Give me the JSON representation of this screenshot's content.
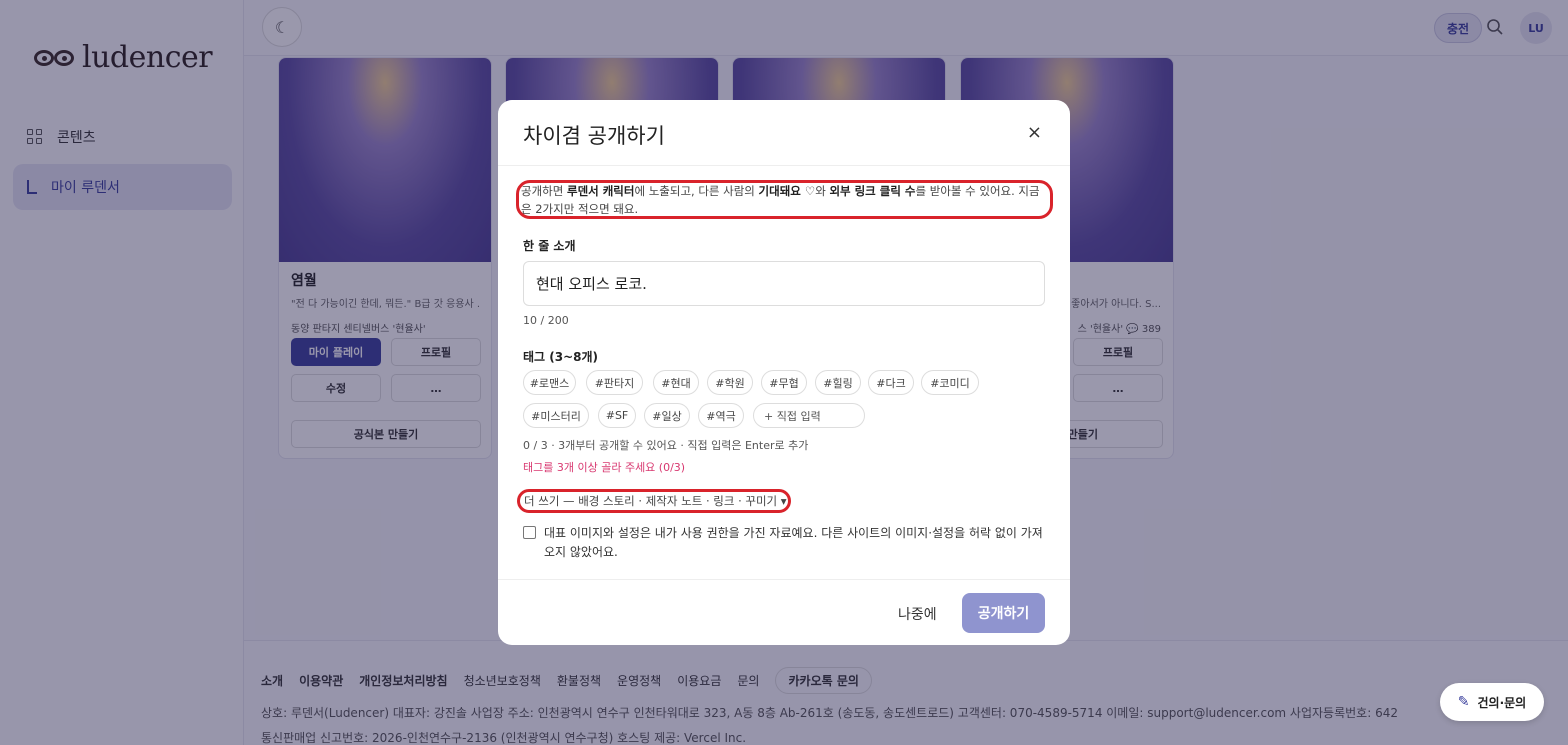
{
  "sidebar": {
    "logo_text": "ludencer",
    "items": [
      {
        "label": "콘텐츠",
        "icon": "grid-icon"
      },
      {
        "label": "마이 루덴서",
        "icon": "l-bracket-icon"
      }
    ]
  },
  "topbar": {
    "charge_label": "충전",
    "avatar_initials": "LU"
  },
  "cards": [
    {
      "title": "염월",
      "desc": "\"전 다 가능이긴 한데, 뭐든.\" B급 갓 응용사 ...",
      "meta": "동양 판타지 센티넬버스 '현율사'",
      "play": "마이 플레이",
      "profile": "프로필",
      "edit": "수정",
      "more": "…",
      "official": "공식본 만들기"
    },
    {
      "desc": "좋아서가 아니다. S...",
      "meta": "스 '현율사'",
      "count": "389",
      "profile": "프로필",
      "more": "…",
      "official": "만들기"
    }
  ],
  "modal": {
    "title": "차이겸 공개하기",
    "close": "×",
    "notice": {
      "p1": "공개하면 ",
      "b1": "루덴서 캐릭터",
      "p2": "에 노출되고, 다른 사람의 ",
      "b2": "기대돼요 ♡",
      "p3": "와 ",
      "b3": "외부 링크 클릭 수",
      "p4": "를 받아볼 수 있어요. 지금은 2가지만 적으면 돼요."
    },
    "intro_label": "한 줄 소개",
    "intro_value": "현대 오피스 로코.",
    "intro_counter": "10 / 200",
    "tags_label": "태그 (3~8개)",
    "tags": [
      "#로맨스",
      "#판타지",
      "#현대",
      "#학원",
      "#무협",
      "#힐링",
      "#다크",
      "#코미디",
      "#미스터리",
      "#SF",
      "#일상",
      "#역극"
    ],
    "tag_input_placeholder": "+ 직접 입력",
    "tags_hint": "0 / 3 · 3개부터 공개할 수 있어요 · 직접 입력은 Enter로 추가",
    "tags_error": "태그를 3개 이상 골라 주세요 (0/3)",
    "more_toggle": "더 쓰기 — 배경 스토리 · 제작자 노트 · 링크 · 꾸미기 ▾",
    "consent": "대표 이미지와 설정은 내가 사용 권한을 가진 자료예요. 다른 사이트의 이미지·설정을 허락 없이 가져오지 않았어요.",
    "later": "나중에",
    "publish": "공개하기"
  },
  "footer": {
    "links": [
      "소개",
      "이용약관",
      "개인정보처리방침",
      "청소년보호정책",
      "환불정책",
      "운영정책",
      "이용요금",
      "문의"
    ],
    "kakao": "카카오톡 문의",
    "info": "상호: 루덴서(Ludencer)   대표자: 강진솔   사업장 주소: 인천광역시 연수구 인천타워대로 323, A동 8층 Ab-261호 (송도동, 송도센트로드)   고객센터: 070-4589-5714   이메일: support@ludencer.com   사업자등록번호: 642",
    "info2": "통신판매업 신고번호: 2026-인천연수구-2136 (인천광역시 연수구청)   호스팅 제공: Vercel Inc."
  },
  "feedback": "건의·문의",
  "colors": {
    "accent": "#3a3f9c",
    "publish_disabled": "#8f94cf",
    "error": "#d83870",
    "annotation_ring": "#d9232b"
  }
}
